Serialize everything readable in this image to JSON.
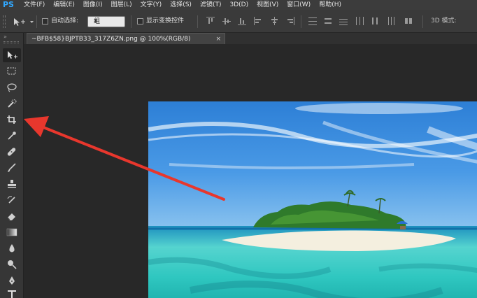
{
  "app": {
    "logo": "PS"
  },
  "menu": {
    "items": [
      "文件(F)",
      "编辑(E)",
      "图像(I)",
      "图层(L)",
      "文字(Y)",
      "选择(S)",
      "滤镜(T)",
      "3D(D)",
      "视图(V)",
      "窗口(W)",
      "帮助(H)"
    ]
  },
  "options": {
    "auto_select_label": "自动选择:",
    "auto_select_value": "组",
    "show_transform_label": "显示变换控件",
    "mode_3d_label": "3D 模式:"
  },
  "document": {
    "tab_title": "~BFB$58}BJPTB33_317Z6ZN.png @ 100%(RGB/8)",
    "close_glyph": "×"
  },
  "colors": {
    "annotation_arrow": "#e8372d",
    "ps_blue": "#31a8ff"
  }
}
